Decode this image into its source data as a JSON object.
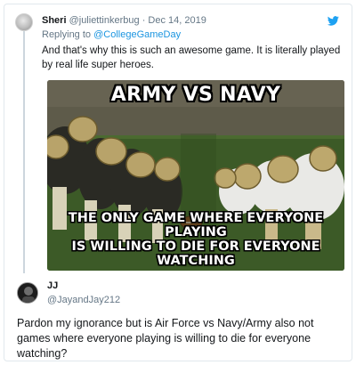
{
  "tweet1": {
    "display_name": "Sheri",
    "handle": "@juliettinkerbug",
    "separator": "·",
    "date": "Dec 14, 2019",
    "replying_prefix": "Replying to ",
    "replying_to": "@CollegeGameDay",
    "text": "And that's why this is such an awesome game. It is literally played by real life super heroes.",
    "media": {
      "top_caption": "ARMY VS NAVY",
      "bottom_line_1": "THE ONLY GAME WHERE EVERYONE PLAYING",
      "bottom_line_2": "IS WILLING TO DIE FOR EVERYONE WATCHING"
    },
    "icons": {
      "avatar": "avatar",
      "brand": "twitter-bird-icon"
    }
  },
  "tweet2": {
    "display_name": "JJ",
    "handle": "@JayandJay212",
    "text": "Pardon my ignorance but is Air Force vs Navy/Army also not games where everyone playing is willing to die for everyone watching?"
  },
  "colors": {
    "link": "#1b95e0",
    "muted": "#657786",
    "text": "#14171a",
    "twitter_blue": "#1da1f2",
    "border": "#e1e8ed"
  }
}
